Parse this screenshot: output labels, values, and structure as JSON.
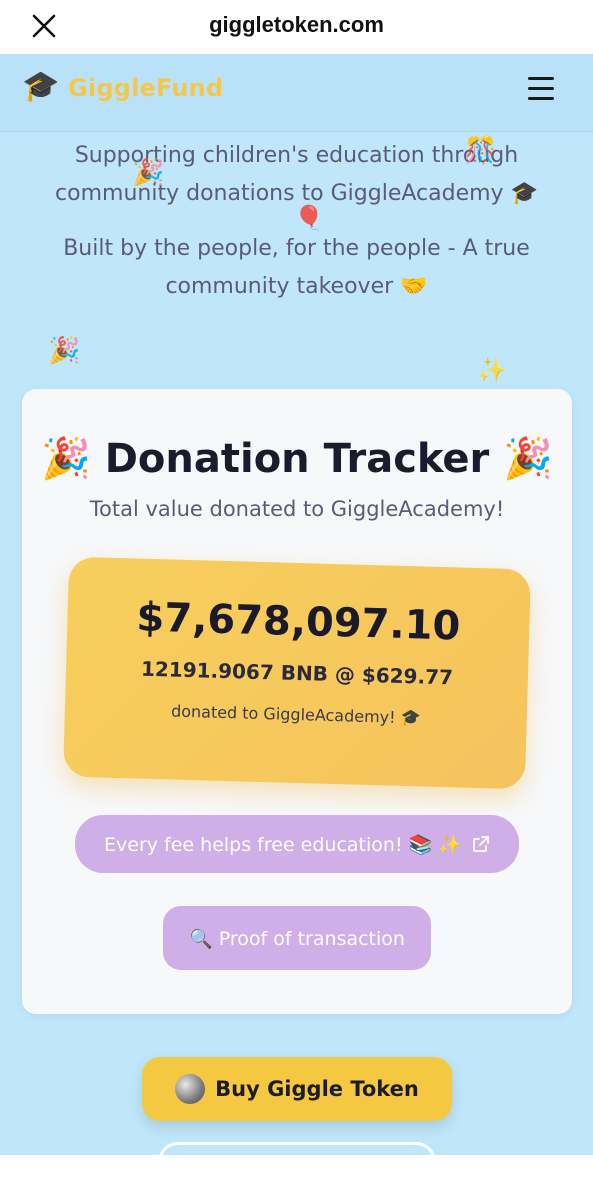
{
  "browser": {
    "url": "giggletoken.com"
  },
  "header": {
    "logo_emoji": "🎓",
    "brand": "GiggleFund"
  },
  "hero": {
    "line1": "Supporting children's education through community donations to GiggleAcademy 🎓",
    "line2": "Built by the people, for the people - A true community takeover 🤝"
  },
  "tracker": {
    "title": "🎉 Donation Tracker 🎉",
    "subtitle": "Total value donated to GiggleAcademy!",
    "amount": "$7,678,097.10",
    "bnb_line": "12191.9067 BNB @ $629.77",
    "donated_line": "donated to GiggleAcademy! 🎓",
    "fee_button": "Every fee helps free education! 📚 ✨",
    "proof_button": "🔍 Proof of transaction"
  },
  "buy_button": "Buy Giggle Token",
  "decorations": [
    "🎉",
    "🎊",
    "🎈",
    "🎉",
    "✨"
  ],
  "colors": {
    "background": "#bfe6fa",
    "brand": "#f3c84a",
    "amount_box": "#f7cf5b",
    "purple_button": "#d0aee8",
    "buy_button": "#f5c842"
  }
}
